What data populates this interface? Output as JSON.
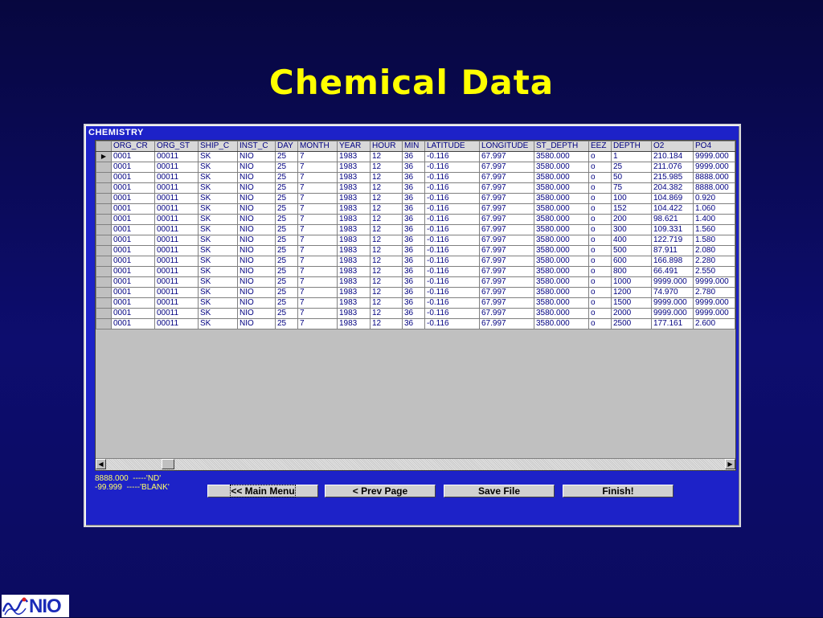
{
  "slide": {
    "title": "Chemical Data",
    "logo_text": "NIO"
  },
  "window": {
    "title": "CHEMISTRY"
  },
  "grid": {
    "columns": [
      "ORG_CR",
      "ORG_ST",
      "SHIP_C",
      "INST_C",
      "DAY",
      "MONTH",
      "YEAR",
      "HOUR",
      "MIN",
      "LATITUDE",
      "LONGITUDE",
      "ST_DEPTH",
      "EEZ",
      "DEPTH",
      "O2",
      "PO4"
    ],
    "rows": [
      [
        "0001",
        "00011",
        "SK",
        "NIO",
        "25",
        "7",
        "1983",
        "12",
        "36",
        "-0.116",
        "67.997",
        "3580.000",
        "o",
        "1",
        "210.184",
        "9999.000"
      ],
      [
        "0001",
        "00011",
        "SK",
        "NIO",
        "25",
        "7",
        "1983",
        "12",
        "36",
        "-0.116",
        "67.997",
        "3580.000",
        "o",
        "25",
        "211.076",
        "9999.000"
      ],
      [
        "0001",
        "00011",
        "SK",
        "NIO",
        "25",
        "7",
        "1983",
        "12",
        "36",
        "-0.116",
        "67.997",
        "3580.000",
        "o",
        "50",
        "215.985",
        "8888.000"
      ],
      [
        "0001",
        "00011",
        "SK",
        "NIO",
        "25",
        "7",
        "1983",
        "12",
        "36",
        "-0.116",
        "67.997",
        "3580.000",
        "o",
        "75",
        "204.382",
        "8888.000"
      ],
      [
        "0001",
        "00011",
        "SK",
        "NIO",
        "25",
        "7",
        "1983",
        "12",
        "36",
        "-0.116",
        "67.997",
        "3580.000",
        "o",
        "100",
        "104.869",
        "0.920"
      ],
      [
        "0001",
        "00011",
        "SK",
        "NIO",
        "25",
        "7",
        "1983",
        "12",
        "36",
        "-0.116",
        "67.997",
        "3580.000",
        "o",
        "152",
        "104.422",
        "1.060"
      ],
      [
        "0001",
        "00011",
        "SK",
        "NIO",
        "25",
        "7",
        "1983",
        "12",
        "36",
        "-0.116",
        "67.997",
        "3580.000",
        "o",
        "200",
        "98.621",
        "1.400"
      ],
      [
        "0001",
        "00011",
        "SK",
        "NIO",
        "25",
        "7",
        "1983",
        "12",
        "36",
        "-0.116",
        "67.997",
        "3580.000",
        "o",
        "300",
        "109.331",
        "1.560"
      ],
      [
        "0001",
        "00011",
        "SK",
        "NIO",
        "25",
        "7",
        "1983",
        "12",
        "36",
        "-0.116",
        "67.997",
        "3580.000",
        "o",
        "400",
        "122.719",
        "1.580"
      ],
      [
        "0001",
        "00011",
        "SK",
        "NIO",
        "25",
        "7",
        "1983",
        "12",
        "36",
        "-0.116",
        "67.997",
        "3580.000",
        "o",
        "500",
        "87.911",
        "2.080"
      ],
      [
        "0001",
        "00011",
        "SK",
        "NIO",
        "25",
        "7",
        "1983",
        "12",
        "36",
        "-0.116",
        "67.997",
        "3580.000",
        "o",
        "600",
        "166.898",
        "2.280"
      ],
      [
        "0001",
        "00011",
        "SK",
        "NIO",
        "25",
        "7",
        "1983",
        "12",
        "36",
        "-0.116",
        "67.997",
        "3580.000",
        "o",
        "800",
        "66.491",
        "2.550"
      ],
      [
        "0001",
        "00011",
        "SK",
        "NIO",
        "25",
        "7",
        "1983",
        "12",
        "36",
        "-0.116",
        "67.997",
        "3580.000",
        "o",
        "1000",
        "9999.000",
        "9999.000"
      ],
      [
        "0001",
        "00011",
        "SK",
        "NIO",
        "25",
        "7",
        "1983",
        "12",
        "36",
        "-0.116",
        "67.997",
        "3580.000",
        "o",
        "1200",
        "74.970",
        "2.780"
      ],
      [
        "0001",
        "00011",
        "SK",
        "NIO",
        "25",
        "7",
        "1983",
        "12",
        "36",
        "-0.116",
        "67.997",
        "3580.000",
        "o",
        "1500",
        "9999.000",
        "9999.000"
      ],
      [
        "0001",
        "00011",
        "SK",
        "NIO",
        "25",
        "7",
        "1983",
        "12",
        "36",
        "-0.116",
        "67.997",
        "3580.000",
        "o",
        "2000",
        "9999.000",
        "9999.000"
      ],
      [
        "0001",
        "00011",
        "SK",
        "NIO",
        "25",
        "7",
        "1983",
        "12",
        "36",
        "-0.116",
        "67.997",
        "3580.000",
        "o",
        "2500",
        "177.161",
        "2.600"
      ]
    ],
    "selected_row": 0,
    "row_pointer_icon": "triangle-right-icon"
  },
  "legend": {
    "lines": [
      "8888.000  -----'ND'",
      "-99.999  -----'BLANK'"
    ]
  },
  "buttons": {
    "main_menu": "<< Main Menu",
    "prev_page": "< Prev Page",
    "save_file": "Save File",
    "finish": "Finish!"
  },
  "icons": {
    "scroll_left": "arrow-left-icon",
    "scroll_right": "arrow-right-icon",
    "logo": "nio-wave-logo-icon"
  },
  "colors": {
    "background": "#0d0d6e",
    "title": "#ffff00",
    "window": "#1d22c8",
    "cell_text": "#000080",
    "legend_text": "#ffff66"
  }
}
